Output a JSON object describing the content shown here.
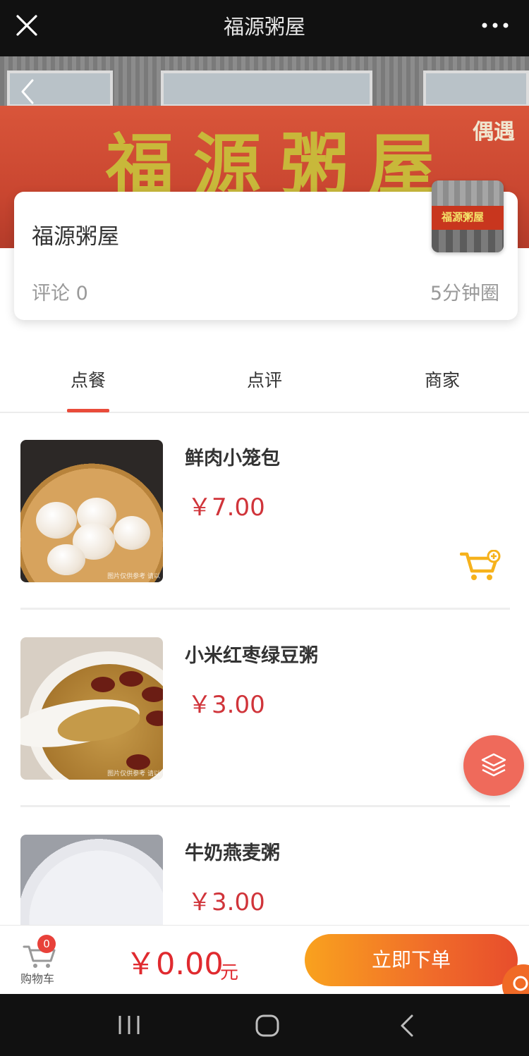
{
  "topbar": {
    "title": "福源粥屋",
    "close_icon": "close-icon",
    "more_icon": "more-icon"
  },
  "hero": {
    "sign_text": "福源粥屋",
    "sign_side": "偶遇"
  },
  "shop": {
    "name": "福源粥屋",
    "comments": "评论 0",
    "circle": "5分钟圈",
    "thumb_text": "福源粥屋"
  },
  "tabs": [
    {
      "label": "点餐",
      "active": true
    },
    {
      "label": "点评",
      "active": false
    },
    {
      "label": "商家",
      "active": false
    }
  ],
  "menu": [
    {
      "name": "鲜肉小笼包",
      "price": "￥7.00",
      "watermark": "图片仅供参考 请以"
    },
    {
      "name": "小米红枣绿豆粥",
      "price": "￥3.00",
      "watermark": "图片仅供参考 请以"
    },
    {
      "name": "牛奶燕麦粥",
      "price": "￥3.00"
    }
  ],
  "cart": {
    "count": "0",
    "label": "购物车",
    "total": "￥0.00",
    "unit": "元"
  },
  "order_button": "立即下单",
  "colors": {
    "accent_red": "#e02a2f",
    "tab_underline": "#e94b3a",
    "order_gradient_start": "#f9a21e",
    "order_gradient_end": "#e74d2c",
    "cart_icon": "#f6b21c"
  }
}
